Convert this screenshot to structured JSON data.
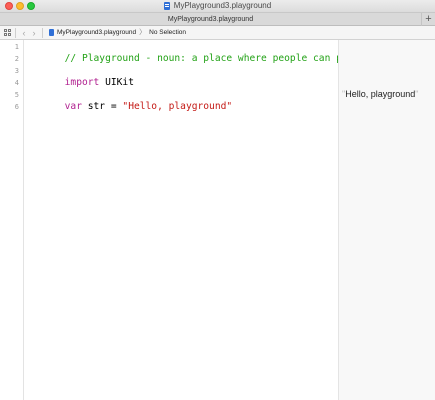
{
  "window": {
    "title": "MyPlayground3.playground"
  },
  "tabbar": {
    "tab_label": "MyPlayground3.playground",
    "add_label": "+"
  },
  "jumpbar": {
    "back_glyph": "‹",
    "forward_glyph": "›",
    "file_crumb": "MyPlayground3.playground",
    "chevron": "〉",
    "selection_crumb": "No Selection"
  },
  "editor": {
    "line_numbers": [
      "1",
      "2",
      "3",
      "4",
      "5",
      "6"
    ],
    "line1": {
      "comment": "// Playground - noun: a place where people can play"
    },
    "line3": {
      "keyword": "import",
      "rest": " UIKit"
    },
    "line5": {
      "keyword": "var",
      "rest": " str = ",
      "string": "\"Hello, playground\""
    }
  },
  "results": {
    "open_quote": "\"",
    "value": "Hello, playground",
    "close_quote": "\""
  },
  "colors": {
    "comment": "#23a217",
    "keyword": "#b01f8f",
    "string": "#c41a16",
    "close_button": "#fc5f57",
    "minimize_button": "#fdbc2e",
    "zoom_button": "#28c840"
  },
  "icons": {
    "file": "playground-file-icon",
    "related_items": "grid-icon"
  }
}
